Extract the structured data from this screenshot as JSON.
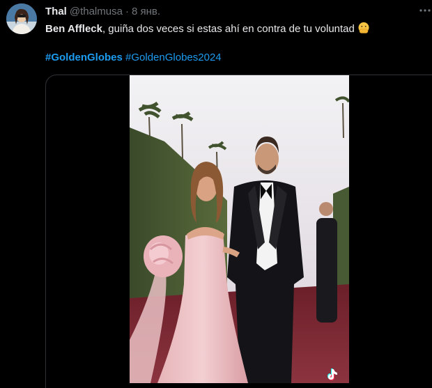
{
  "tweet": {
    "author": {
      "display_name": "Thal",
      "handle": "@thalmusa",
      "avatar_icon": "user-avatar-photo"
    },
    "separator": "·",
    "timestamp": "8 янв.",
    "more_icon": "more-horizontal-icon",
    "text": {
      "mention": "Ben Affleck",
      "body": ", guiña dos veces si estas ahí en contra de tu voluntad",
      "emoji": "face-with-hand-over-mouth"
    },
    "hashtags": [
      "#GoldenGlobes",
      "#GoldenGlobes2024"
    ],
    "media": {
      "kind": "video",
      "watermark_icon": "tiktok-icon"
    }
  },
  "colors": {
    "background": "#000000",
    "text": "#e7e9ea",
    "secondary": "#71767b",
    "link": "#1d9bf0",
    "border": "#2f3336"
  }
}
